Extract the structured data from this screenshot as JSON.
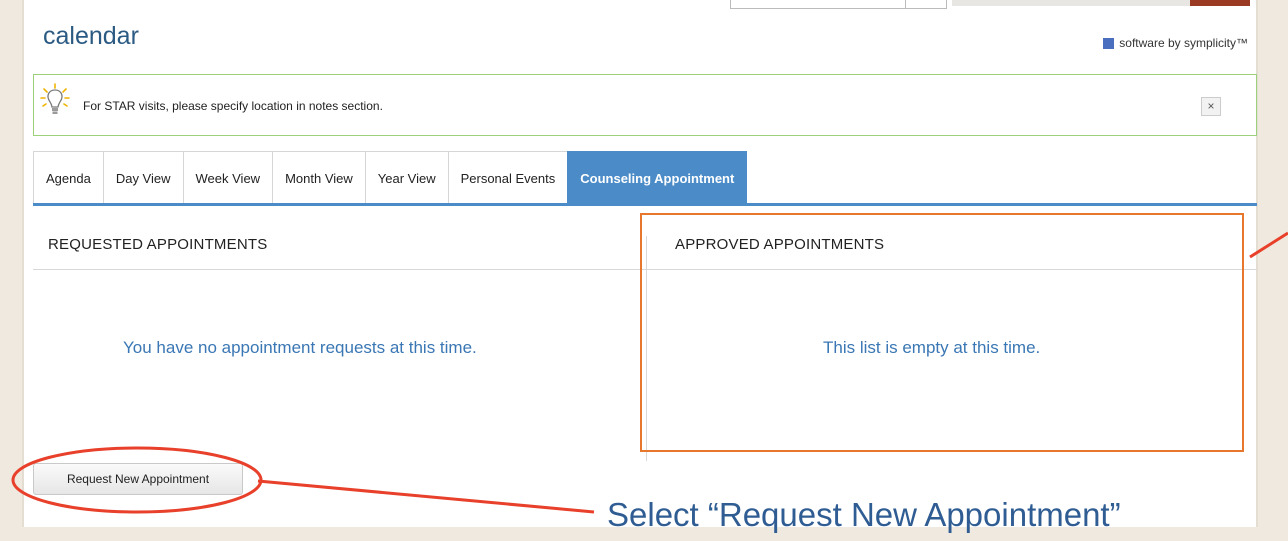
{
  "header": {
    "title": "calendar",
    "brand": "software by symplicity™"
  },
  "notice": {
    "text": "For STAR visits, please specify location in notes section.",
    "close_label": "×",
    "icon": "lightbulb-icon"
  },
  "tabs": [
    {
      "label": "Agenda",
      "active": false
    },
    {
      "label": "Day View",
      "active": false
    },
    {
      "label": "Week View",
      "active": false
    },
    {
      "label": "Month View",
      "active": false
    },
    {
      "label": "Year View",
      "active": false
    },
    {
      "label": "Personal Events",
      "active": false
    },
    {
      "label": "Counseling Appointment",
      "active": true
    }
  ],
  "requested": {
    "heading": "REQUESTED APPOINTMENTS",
    "empty_text": "You have no appointment requests at this time."
  },
  "approved": {
    "heading": "APPROVED APPOINTMENTS",
    "empty_text": "This list is empty at this time."
  },
  "actions": {
    "request_label": "Request New Appointment"
  },
  "annotation": {
    "text": "Select “Request New Appointment”",
    "highlight_color": "#e8772e",
    "callout_color": "#e8402a"
  },
  "colors": {
    "accent": "#4a8bc8",
    "title": "#2b5a83",
    "notice_border": "#9dd07a",
    "message": "#3a77b4"
  }
}
